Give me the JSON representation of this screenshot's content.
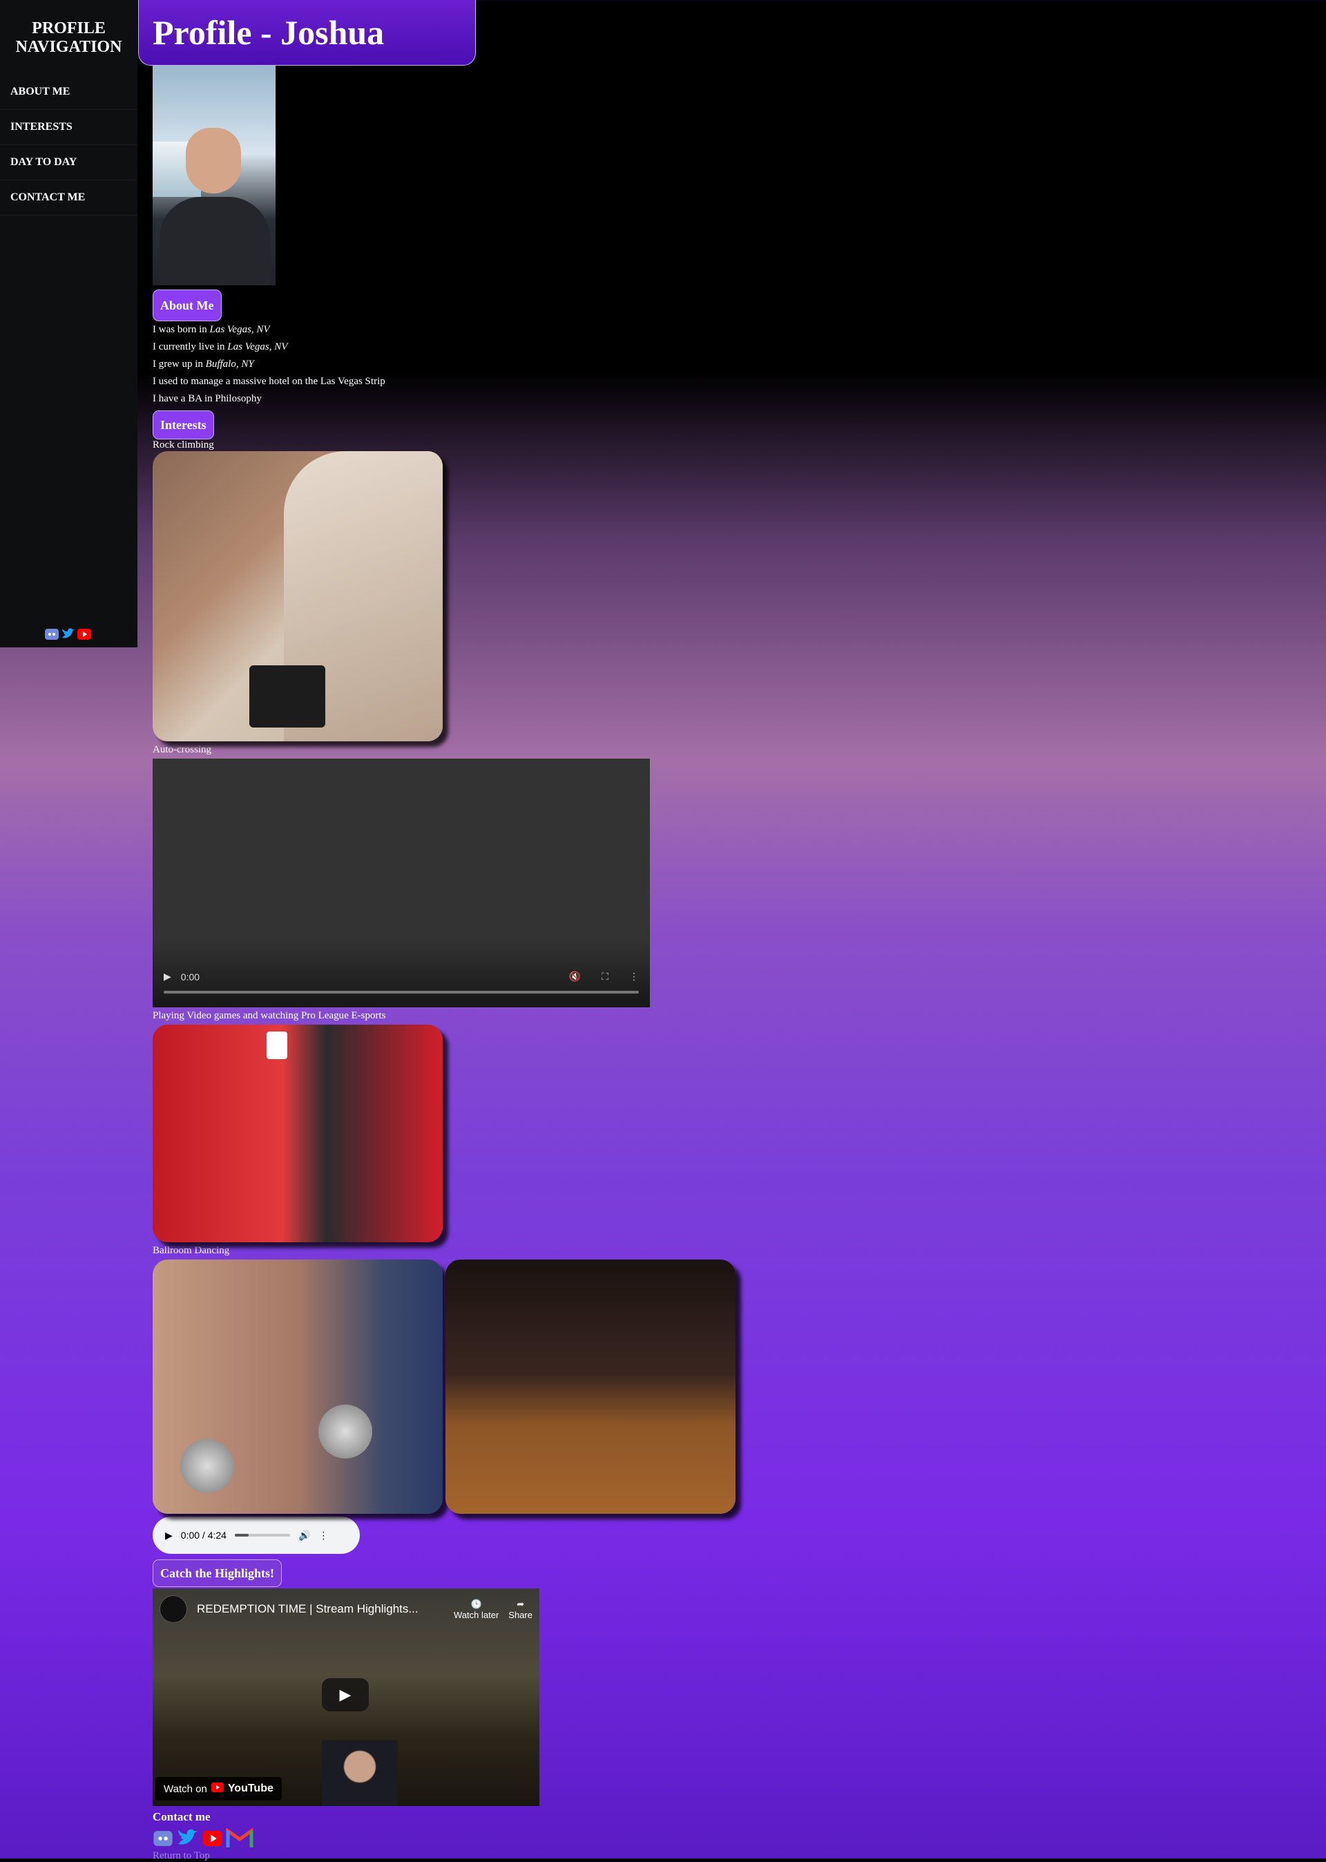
{
  "sidebar": {
    "title": "PROFILE NAVIGATION",
    "nav": [
      "ABOUT ME",
      "INTERESTS",
      "DAY TO DAY",
      "CONTACT ME"
    ]
  },
  "header": {
    "title": "Profile - Joshua Gunn"
  },
  "about": {
    "heading": "About Me",
    "facts": [
      {
        "pre": "I was born in ",
        "em": "Las Vegas, NV"
      },
      {
        "pre": "I currently live in ",
        "em": "Las Vegas, NV"
      },
      {
        "pre": "I grew up in ",
        "em": "Buffalo, NY"
      },
      {
        "pre": "I used to manage a massive hotel on the Las Vegas Strip",
        "em": ""
      },
      {
        "pre": "I have a BA in Philosophy",
        "em": ""
      }
    ]
  },
  "interests": {
    "heading": "Interests",
    "rock": "Rock climbing",
    "auto": "Auto-crossing",
    "games": "Playing Video games and watching Pro League E-sports",
    "ballroom": "Ballroom Dancing"
  },
  "video": {
    "time": "0:00"
  },
  "audio": {
    "time": "0:00 / 4:24"
  },
  "highlights": {
    "heading": "Catch the Highlights!",
    "title": "REDEMPTION TIME | Stream Highlights...",
    "watch_later": "Watch later",
    "share": "Share",
    "watch_on": "Watch on",
    "youtube": "YouTube"
  },
  "contact": {
    "heading": "Contact me",
    "return": "Return to Top"
  },
  "colors": {
    "discord": "#7289da",
    "twitter": "#1da1f2",
    "youtube": "#ff0000",
    "accent": "#8a3ef0"
  }
}
